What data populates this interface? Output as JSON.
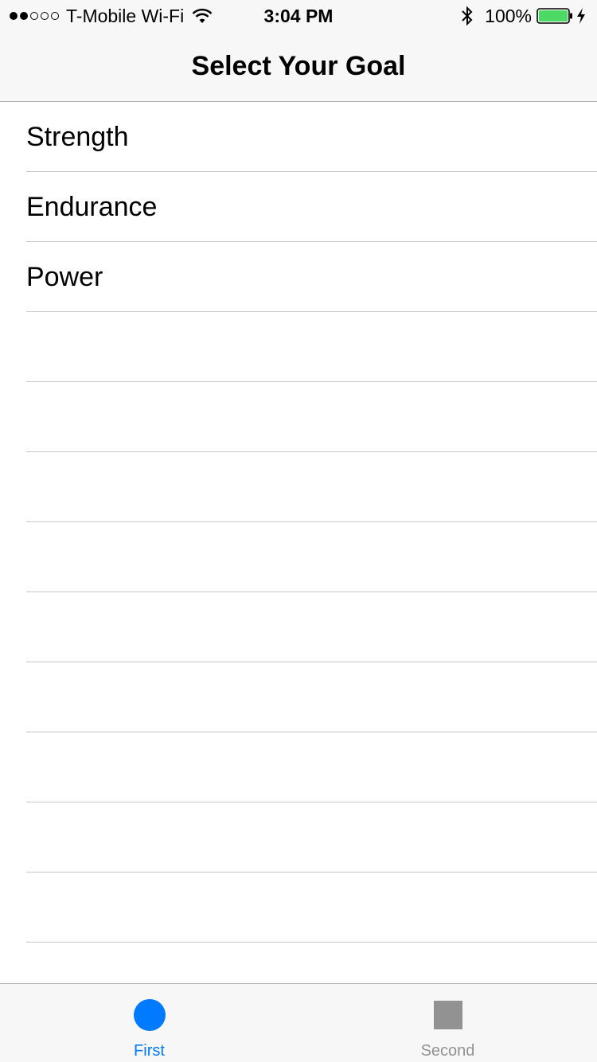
{
  "status_bar": {
    "carrier": "T-Mobile Wi-Fi",
    "time": "3:04 PM",
    "battery_percent": "100%",
    "signal_bars_filled": 2,
    "signal_bars_total": 5,
    "battery_color": "#4cd964"
  },
  "nav": {
    "title": "Select Your Goal"
  },
  "goals": {
    "items": [
      {
        "label": "Strength"
      },
      {
        "label": "Endurance"
      },
      {
        "label": "Power"
      },
      {
        "label": ""
      },
      {
        "label": ""
      },
      {
        "label": ""
      },
      {
        "label": ""
      },
      {
        "label": ""
      },
      {
        "label": ""
      },
      {
        "label": ""
      },
      {
        "label": ""
      },
      {
        "label": ""
      },
      {
        "label": ""
      }
    ]
  },
  "tab_bar": {
    "tabs": [
      {
        "label": "First",
        "icon": "circle-icon",
        "selected": true
      },
      {
        "label": "Second",
        "icon": "square-icon",
        "selected": false
      }
    ],
    "accent_color": "#007aff",
    "inactive_color": "#929292"
  }
}
